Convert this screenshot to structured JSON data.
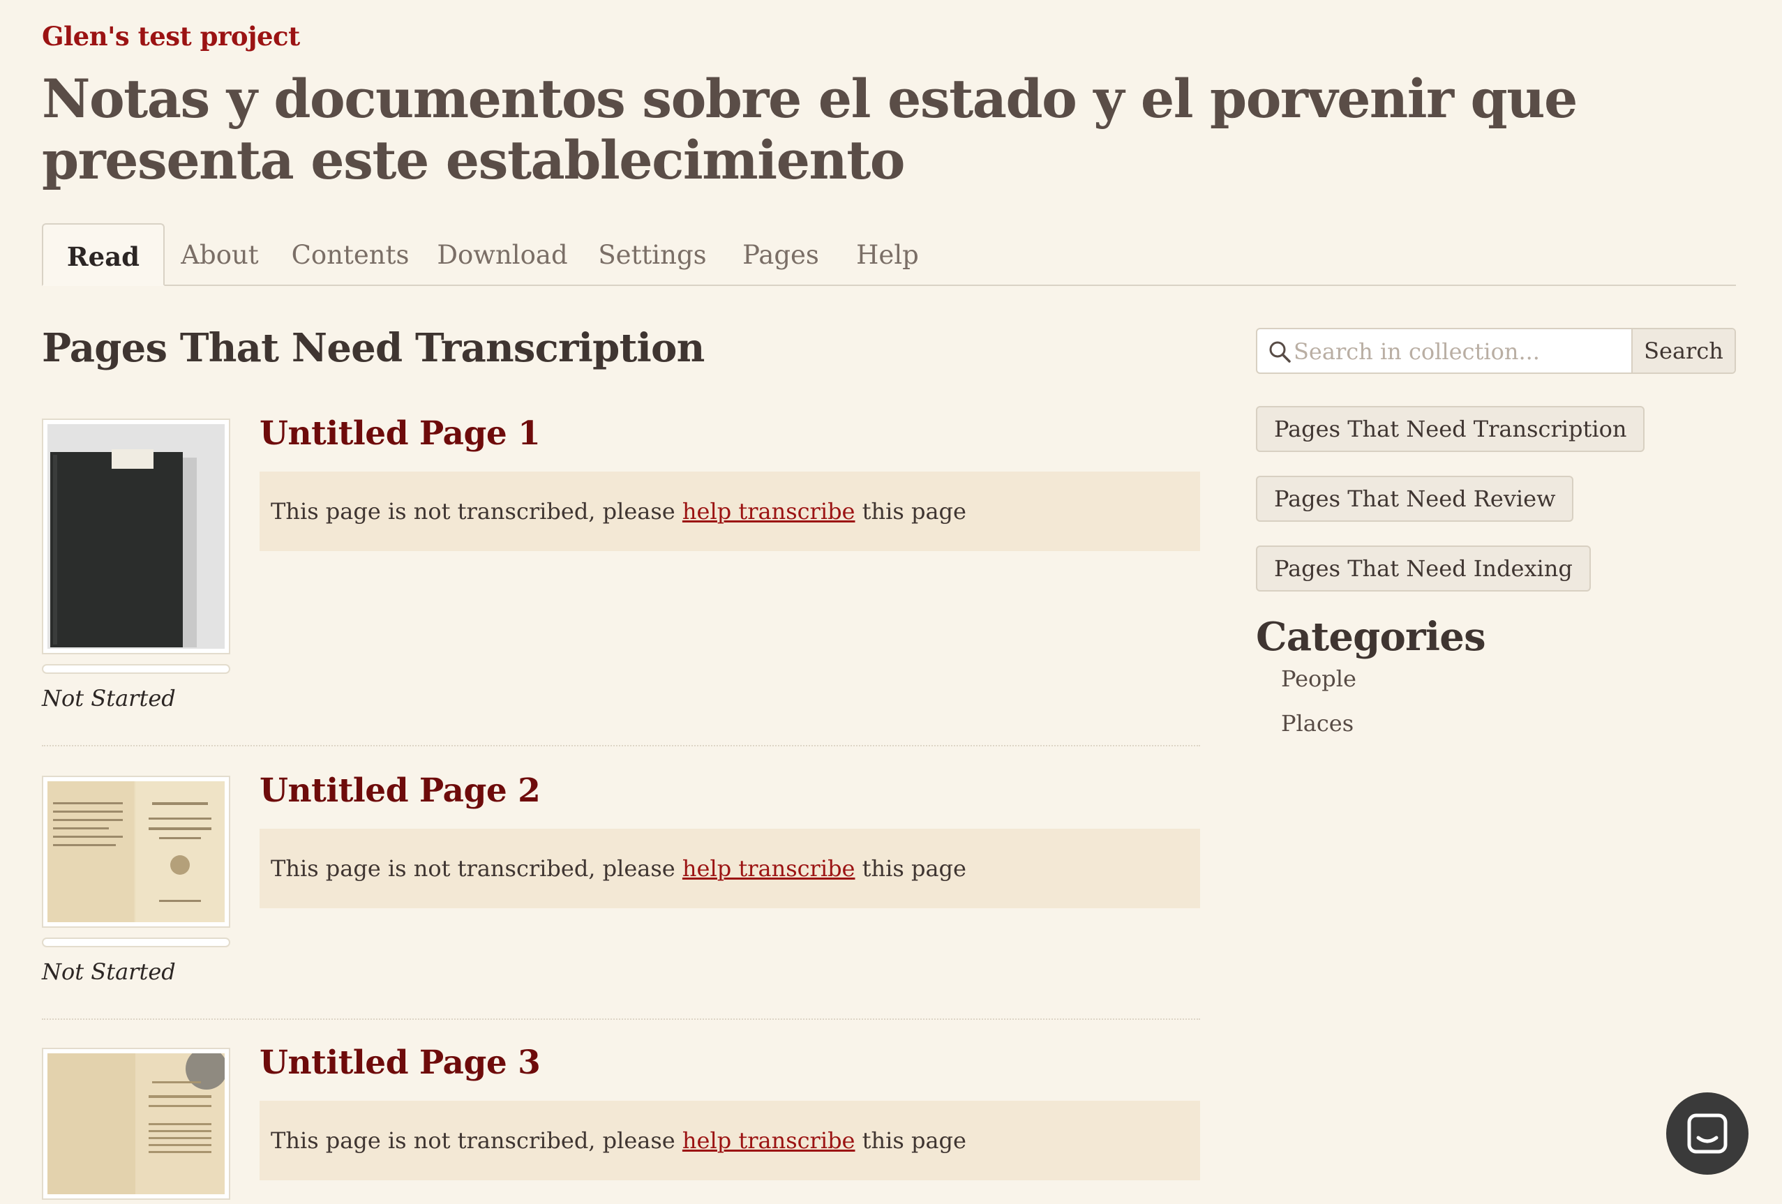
{
  "header": {
    "project_link": "Glen's test project",
    "work_title": "Notas y documentos sobre el estado y el porvenir que presenta este establecimiento"
  },
  "tabs": [
    {
      "label": "Read",
      "active": true
    },
    {
      "label": "About"
    },
    {
      "label": "Contents"
    },
    {
      "label": "Download"
    },
    {
      "label": "Settings"
    },
    {
      "label": "Pages"
    },
    {
      "label": "Help"
    }
  ],
  "main": {
    "section_title": "Pages That Need Transcription",
    "pages": [
      {
        "title": "Untitled Page 1",
        "notice_before": "This page is not transcribed, please",
        "notice_link": "help transcribe",
        "notice_after": "this page",
        "status": "Not Started",
        "progress": 0
      },
      {
        "title": "Untitled Page 2",
        "notice_before": "This page is not transcribed, please",
        "notice_link": "help transcribe",
        "notice_after": "this page",
        "status": "Not Started",
        "progress": 0
      },
      {
        "title": "Untitled Page 3",
        "notice_before": "This page is not transcribed, please",
        "notice_link": "help transcribe",
        "notice_after": "this page"
      }
    ]
  },
  "sidebar": {
    "search": {
      "placeholder": "Search in collection...",
      "value": "",
      "button_label": "Search"
    },
    "filters": [
      "Pages That Need Transcription",
      "Pages That Need Review",
      "Pages That Need Indexing"
    ],
    "categories_title": "Categories",
    "categories": [
      "People",
      "Places"
    ]
  },
  "colors": {
    "background": "#f9f4ea",
    "accent": "#9b1313",
    "entry_title": "#6e0b0b",
    "notice_bg": "#f3e8d5",
    "chat_bubble": "#3a3a3a"
  },
  "icons": {
    "search": "search-icon",
    "chat": "chat-icon"
  }
}
